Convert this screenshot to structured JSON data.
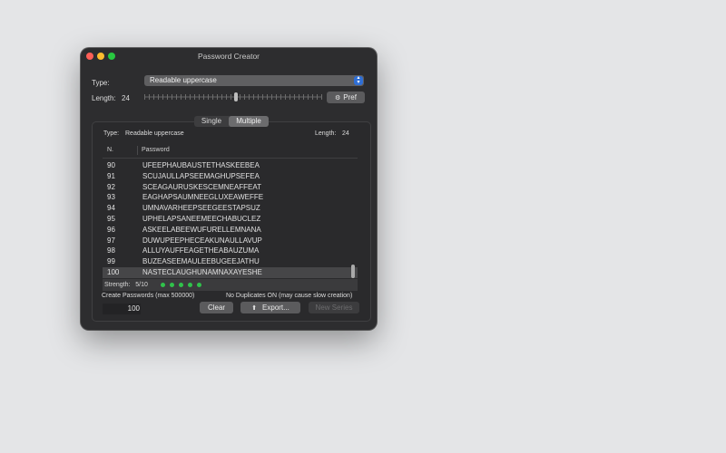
{
  "window": {
    "title": "Password Creator"
  },
  "settings": {
    "type_label": "Type:",
    "type_value": "Readable uppercase",
    "length_label": "Length:",
    "length_value": "24",
    "length_slider_level": 0.5,
    "pref_label": "Pref",
    "pref_icon": "gear-icon"
  },
  "mode": {
    "options": [
      "Single",
      "Multiple"
    ],
    "selected": "Multiple"
  },
  "summary": {
    "type_label": "Type:",
    "type_value": "Readable uppercase",
    "length_label": "Length:",
    "length_value": "24"
  },
  "table": {
    "columns": [
      "N.",
      "Password"
    ],
    "rows": [
      {
        "n": "90",
        "password": "UFEEPHAUBAUSTETHASKEEBEA"
      },
      {
        "n": "91",
        "password": "SCUJAULLAPSEEMAGHUPSEFEA"
      },
      {
        "n": "92",
        "password": "SCEAGAURUSKESCEMNEAFFEAT"
      },
      {
        "n": "93",
        "password": "EAGHAPSAUMNEEGLUXEAWEFFE"
      },
      {
        "n": "94",
        "password": "UMNAVARHEEPSEEGEESTAPSUZ"
      },
      {
        "n": "95",
        "password": "UPHELAPSANEEMEECHABUCLEZ"
      },
      {
        "n": "96",
        "password": "ASKEELABEEWUFURELLEMNANA"
      },
      {
        "n": "97",
        "password": "DUWUPEEPHECEAKUNAULLAVUP"
      },
      {
        "n": "98",
        "password": "ALLUYAUFFEAGETHEABAUZUMA"
      },
      {
        "n": "99",
        "password": "BUZEASEEMAULEEBUGEEJATHU"
      },
      {
        "n": "100",
        "password": "NASTECLAUGHUNAMNAXAYESHE"
      }
    ],
    "selected_row": "100"
  },
  "strength": {
    "label": "Strength:",
    "value": "5/10",
    "dots": 5,
    "dot_color": "#30c24b"
  },
  "footer": {
    "create_label": "Create Passwords (max 500000)",
    "duplicates_note": "No Duplicates ON (may cause slow creation)",
    "quantity": "100",
    "clear_label": "Clear",
    "export_label": "Export...",
    "export_icon": "share-icon",
    "new_series_label": "New Series"
  },
  "colors": {
    "window_bg": "#2d2d2f",
    "accent": "#2f6fd6",
    "close": "#ff5f57",
    "minimize": "#febc2e",
    "maximize": "#28c840"
  }
}
